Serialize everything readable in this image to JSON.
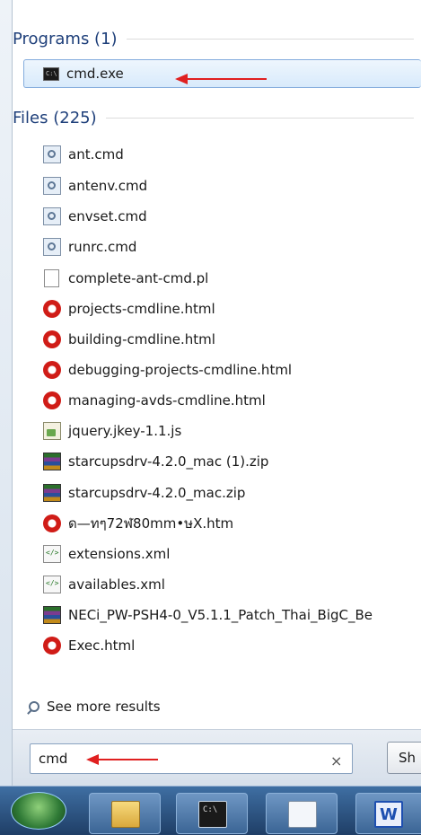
{
  "groups": {
    "programs_label": "Programs (1)",
    "files_label": "Files (225)"
  },
  "programs": [
    {
      "name": "cmd.exe",
      "icon": "cmd-icon"
    }
  ],
  "files": [
    {
      "name": "ant.cmd",
      "icon": "script-icon"
    },
    {
      "name": "antenv.cmd",
      "icon": "script-icon"
    },
    {
      "name": "envset.cmd",
      "icon": "script-icon"
    },
    {
      "name": "runrc.cmd",
      "icon": "script-icon"
    },
    {
      "name": "complete-ant-cmd.pl",
      "icon": "file-icon"
    },
    {
      "name": "projects-cmdline.html",
      "icon": "opera-icon"
    },
    {
      "name": "building-cmdline.html",
      "icon": "opera-icon"
    },
    {
      "name": "debugging-projects-cmdline.html",
      "icon": "opera-icon"
    },
    {
      "name": "managing-avds-cmdline.html",
      "icon": "opera-icon"
    },
    {
      "name": "jquery.jkey-1.1.js",
      "icon": "js-icon"
    },
    {
      "name": "starcupsdrv-4.2.0_mac (1).zip",
      "icon": "zip-icon"
    },
    {
      "name": "starcupsdrv-4.2.0_mac.zip",
      "icon": "zip-icon"
    },
    {
      "name": "ด—ทๆ72ฬ80mm•ษX.htm",
      "icon": "opera-icon"
    },
    {
      "name": "extensions.xml",
      "icon": "xml-icon"
    },
    {
      "name": "availables.xml",
      "icon": "xml-icon"
    },
    {
      "name": "NECi_PW-PSH4-0_V5.1.1_Patch_Thai_BigC_Be",
      "icon": "zip-icon"
    },
    {
      "name": "Exec.html",
      "icon": "opera-icon"
    }
  ],
  "see_more": "See more results",
  "search": {
    "value": "cmd",
    "clear": "×"
  },
  "shutdown_label": "Sh",
  "taskbar": {
    "word_label": "W"
  },
  "colors": {
    "header_blue": "#1e3f7a",
    "selection": "#d8eafb",
    "arrow_red": "#e02020"
  }
}
